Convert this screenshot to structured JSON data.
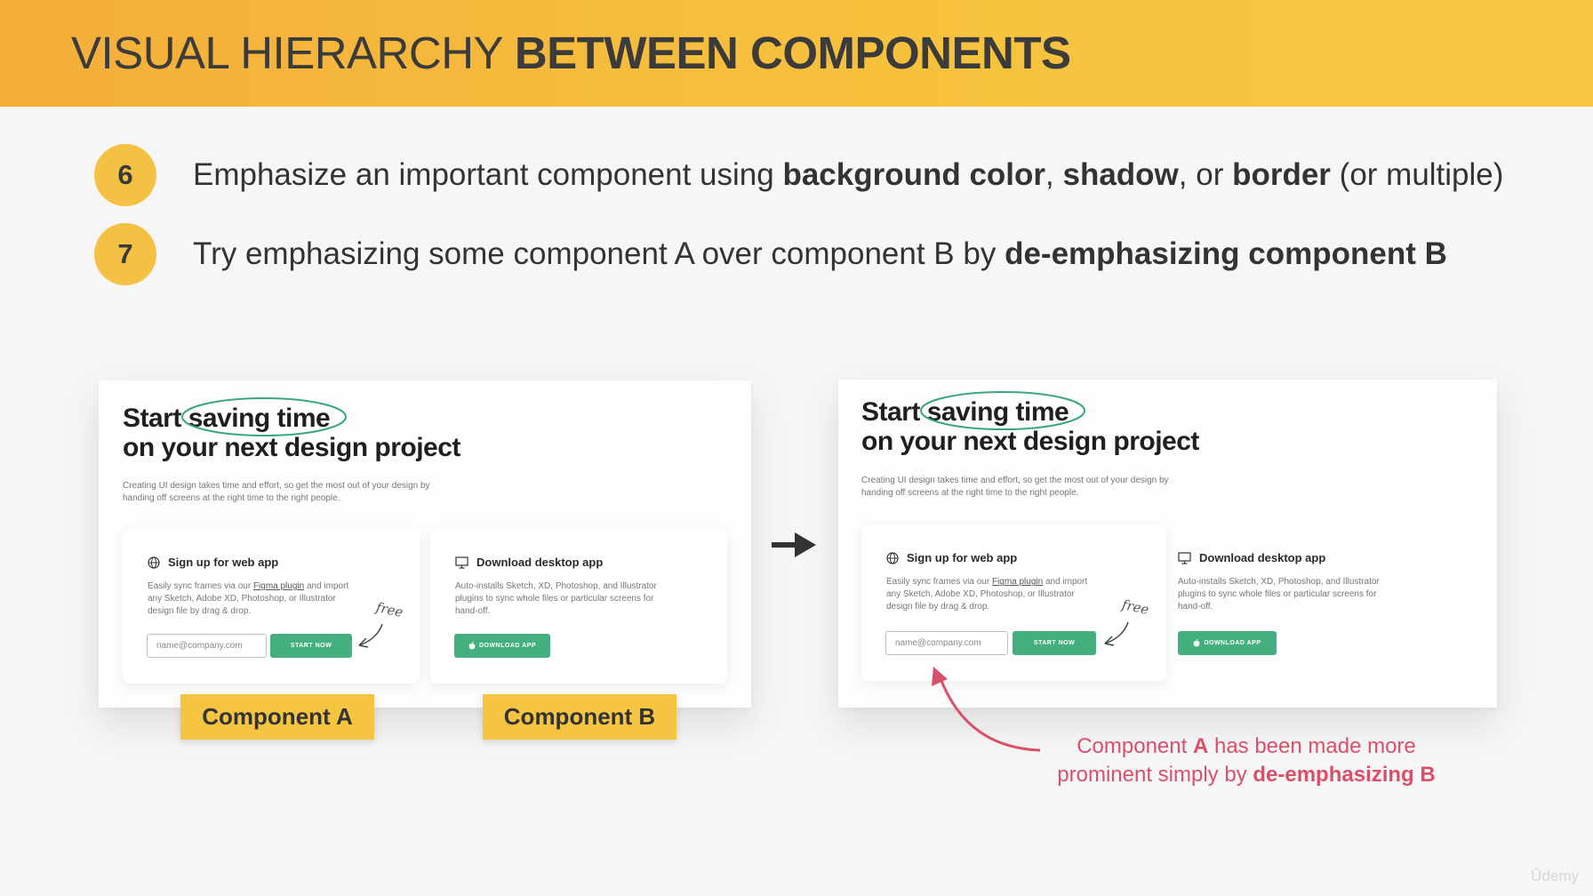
{
  "header": {
    "title_light": "VISUAL HIERARCHY ",
    "title_bold": "BETWEEN COMPONENTS"
  },
  "points": [
    {
      "number": "6",
      "segments": [
        {
          "t": "Emphasize an important component using ",
          "b": false
        },
        {
          "t": "background color",
          "b": true
        },
        {
          "t": ", ",
          "b": false
        },
        {
          "t": "shadow",
          "b": true
        },
        {
          "t": ", or ",
          "b": false
        },
        {
          "t": "border",
          "b": true
        },
        {
          "t": " (or multiple)",
          "b": false
        }
      ]
    },
    {
      "number": "7",
      "segments": [
        {
          "t": "Try emphasizing some component A over component B by ",
          "b": false
        },
        {
          "t": "de-emphasizing component B",
          "b": true
        }
      ]
    }
  ],
  "mock": {
    "hero_start": "Start ",
    "hero_highlight": "saving time",
    "hero_line2": "on your next design project",
    "description": "Creating UI design takes time and effort, so get the most out of your design by handing off screens at the right time to the right people.",
    "signup": {
      "title": "Sign up for web app",
      "desc_before": "Easily sync frames via our ",
      "desc_link": "Figma plugin",
      "desc_after": " and import any Sketch, Adobe XD, Photoshop, or Illustrator design file by drag & drop.",
      "placeholder": "name@company.com",
      "button": "START NOW",
      "free": "free"
    },
    "download": {
      "title": "Download desktop app",
      "desc": "Auto-installs Sketch, XD, Photoshop, and Illustrator plugins to sync whole files or particular screens for hand-off.",
      "button": "DOWNLOAD APP"
    }
  },
  "labels": {
    "component_a": "Component A",
    "component_b": "Component B"
  },
  "note": {
    "line1_before": "Component ",
    "line1_bold": "A",
    "line1_after": " has been made more",
    "line2_before": "prominent simply by ",
    "line2_bold": "de-emphasizing B"
  },
  "watermark": "Ûdemy",
  "colors": {
    "header_start": "#f4ae3a",
    "header_end": "#f7c744",
    "accent_yellow": "#f5c541",
    "button_green": "#45b07f",
    "highlight_teal": "#3aa585",
    "note_red": "#d9506a"
  },
  "icons": {
    "arrow": "right-arrow-icon",
    "signup": "globe-icon",
    "download": "monitor-icon",
    "button": "apple-icon"
  }
}
